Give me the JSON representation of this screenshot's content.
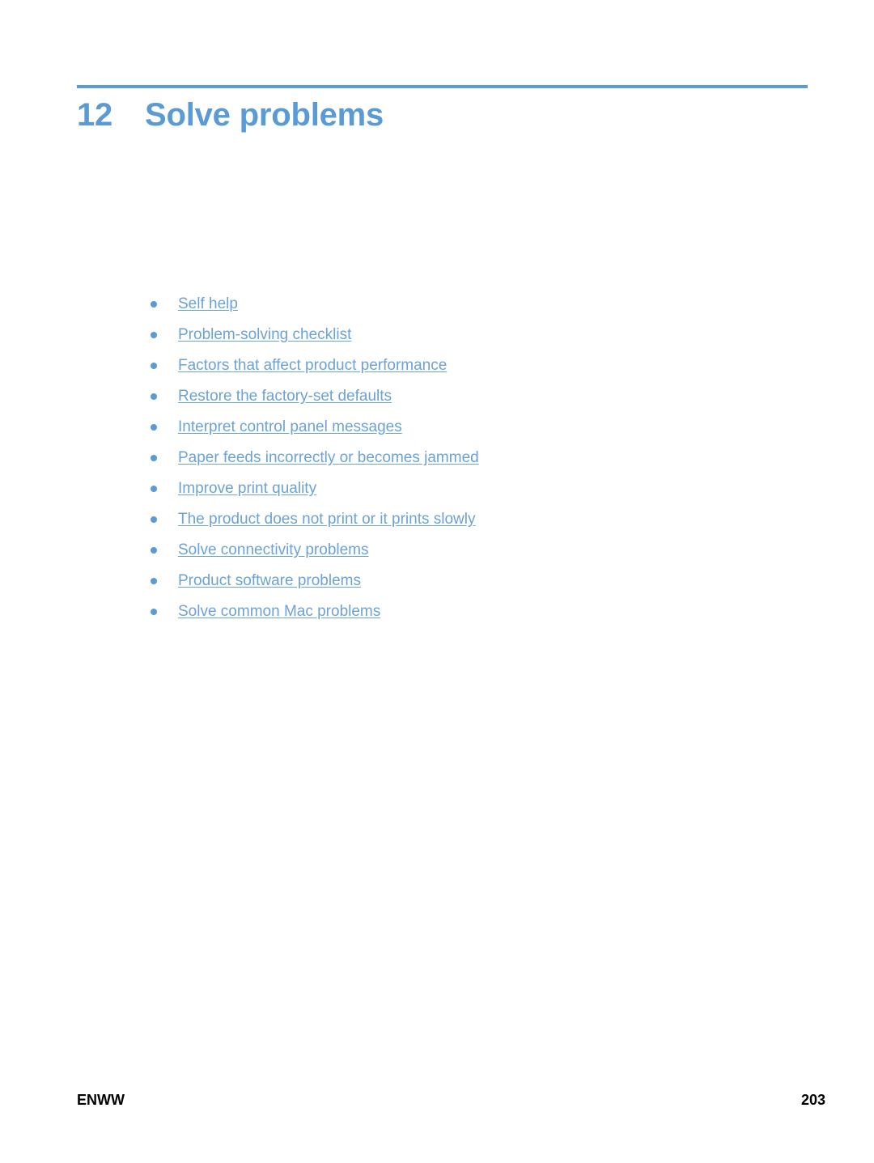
{
  "document": {
    "page_background": "#ffffff",
    "accent_color": "#5b9bd5",
    "link_color": "#6ba3d8"
  },
  "chapter": {
    "number": "12",
    "title": "Solve problems"
  },
  "toc": {
    "items": [
      {
        "label": "Self help"
      },
      {
        "label": "Problem-solving checklist"
      },
      {
        "label": "Factors that affect product performance"
      },
      {
        "label": "Restore the factory-set defaults"
      },
      {
        "label": "Interpret control panel messages"
      },
      {
        "label": "Paper feeds incorrectly or becomes jammed"
      },
      {
        "label": "Improve print quality"
      },
      {
        "label": "The product does not print or it prints slowly"
      },
      {
        "label": "Solve connectivity problems"
      },
      {
        "label": "Product software problems"
      },
      {
        "label": "Solve common Mac problems"
      }
    ]
  },
  "footer": {
    "left": "ENWW",
    "page_number": "203"
  }
}
